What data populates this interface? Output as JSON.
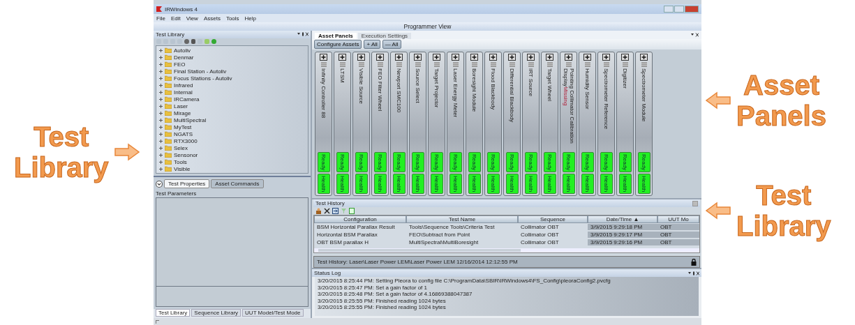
{
  "left_callouts": [
    {
      "lines": [
        "Test",
        "Library"
      ]
    }
  ],
  "right_callouts": [
    {
      "lines": [
        "Asset",
        "Panels"
      ]
    },
    {
      "lines": [
        "Test",
        "Library"
      ]
    }
  ],
  "window": {
    "title": "IRWindows 4",
    "menu": [
      "File",
      "Edit",
      "View",
      "Assets",
      "Tools",
      "Help"
    ],
    "view_title": "Programmer View"
  },
  "test_library": {
    "title": "Test Library",
    "items": [
      {
        "label": "Autoliv",
        "expanded": false
      },
      {
        "label": "Denmar",
        "expanded": false
      },
      {
        "label": "FEO",
        "expanded": false
      },
      {
        "label": "Final Station - Autoliv",
        "expanded": false
      },
      {
        "label": "Focus Stations - Autoliv",
        "expanded": false
      },
      {
        "label": "Infrared",
        "expanded": false
      },
      {
        "label": "Internal",
        "expanded": false
      },
      {
        "label": "IRCamera",
        "expanded": false
      },
      {
        "label": "Laser",
        "expanded": false
      },
      {
        "label": "Mirage",
        "expanded": false
      },
      {
        "label": "MultiSpectral",
        "expanded": false
      },
      {
        "label": "MyTest",
        "expanded": false
      },
      {
        "label": "NGATS",
        "expanded": false
      },
      {
        "label": "RTX3000",
        "expanded": false
      },
      {
        "label": "Selex",
        "expanded": false
      },
      {
        "label": "Sensonor",
        "expanded": false
      },
      {
        "label": "Tools",
        "expanded": false
      },
      {
        "label": "Visible",
        "expanded": false
      }
    ]
  },
  "properties": {
    "tabs": [
      {
        "label": "Test Properties",
        "selected": true
      },
      {
        "label": "Asset Commands",
        "selected": false
      }
    ],
    "section": "Test Parameters"
  },
  "bottom_tabs": [
    {
      "label": "Test Library",
      "selected": true
    },
    {
      "label": "Sequence Library",
      "selected": false
    },
    {
      "label": "UUT Model/Test Mode",
      "selected": false
    }
  ],
  "assets": {
    "tabs": [
      {
        "label": "Asset Panels",
        "selected": true
      },
      {
        "label": "Execution Settings",
        "selected": false
      }
    ],
    "buttons": [
      "Configure Assets",
      "+ All",
      "— All"
    ],
    "panels": [
      {
        "name": "Infinity Controller 88",
        "buttons": [
          "Ready",
          "Health"
        ]
      },
      {
        "name": "LTSM",
        "buttons": [
          "Ready",
          "Health"
        ]
      },
      {
        "name": "Visible Source",
        "buttons": [
          "Ready",
          "Health"
        ]
      },
      {
        "name": "FEO Filter Wheel",
        "buttons": [
          "Ready",
          "Health"
        ]
      },
      {
        "name": "Newport SMC100",
        "buttons": [
          "Ready",
          "Health"
        ]
      },
      {
        "name": "Source Select",
        "buttons": [
          "Ready",
          "Health"
        ]
      },
      {
        "name": "Target Projector",
        "buttons": [
          "Ready",
          "Health"
        ]
      },
      {
        "name": "Laser Energy Meter",
        "buttons": [
          "Ready",
          "Health"
        ]
      },
      {
        "name": "Boresight Module",
        "buttons": [
          "Ready",
          "Health"
        ]
      },
      {
        "name": "Flood Blackbody",
        "buttons": [
          "Ready",
          "Health"
        ]
      },
      {
        "name": "Differential Blackbody",
        "buttons": [
          "Ready",
          "Health"
        ]
      },
      {
        "name": "IRT Source",
        "buttons": [
          "Ready",
          "Health"
        ]
      },
      {
        "name": "Target Wheel",
        "buttons": [
          "Ready",
          "Health"
        ]
      },
      {
        "name": "Pointing Collimator Calibration Display",
        "status": "Missing",
        "buttons": [
          "Ready",
          "Health"
        ]
      },
      {
        "name": "Humidity Sensor",
        "buttons": [
          "Ready",
          "Health"
        ]
      },
      {
        "name": "Spectrometer Reference",
        "buttons": [
          "Ready",
          "Health"
        ]
      },
      {
        "name": "Digitizer",
        "buttons": [
          "Ready",
          "Health"
        ]
      },
      {
        "name": "Spectrometer Module",
        "buttons": [
          "Ready",
          "Health"
        ]
      }
    ]
  },
  "test_history": {
    "title": "Test History",
    "columns": [
      "Configuration",
      "Test Name",
      "Sequence",
      "Date/Time ▲",
      "UUT Mo"
    ],
    "rows": [
      [
        "BSM Horizontal Parallax Result",
        "Tools\\Sequence Tools\\Criteria Test",
        "Collimator OBT",
        "3/9/2015 9:29:18 PM",
        "OBT"
      ],
      [
        "Horizontal BSM Parallax",
        "FEO\\Subtract from Point",
        "Collimator OBT",
        "3/9/2015 9:29:17 PM",
        "OBT"
      ],
      [
        "OBT BSM parallax H",
        "MultiSpectral\\MultiBoresight",
        "Collimator OBT",
        "3/9/2015 9:29:16 PM",
        "OBT"
      ]
    ],
    "footer": "Test History: Laser\\Laser Power LEM\\Laser Power LEM  12/16/2014 12:12:55 PM"
  },
  "status_log": {
    "title": "Status Log",
    "lines": [
      "3/20/2015 8:25:44 PM:  Setting Pleora to config file C:\\ProgramData\\SBIR\\IRWindows4\\FS_Config\\pleoraConfig2.pvcfg",
      "3/20/2015 8:25:47 PM:  Set a gain factor of 1",
      "3/20/2015 8:25:48 PM:  Set a gain factor of 4.16869388047387",
      "3/20/2015 8:25:55 PM:  Finished reading 1024 bytes",
      "3/20/2015 8:25:55 PM:  Finished reading 1024 bytes"
    ]
  }
}
